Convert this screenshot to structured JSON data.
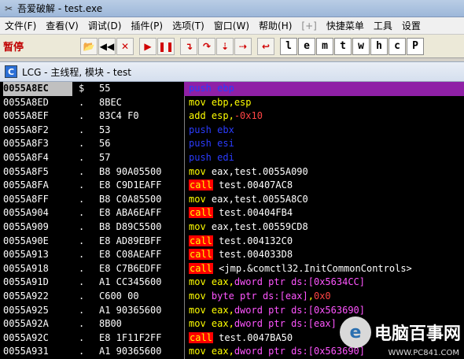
{
  "window": {
    "title": "吾爱破解 - test.exe"
  },
  "menu": [
    {
      "label": "文件(F)",
      "disabled": false
    },
    {
      "label": "查看(V)",
      "disabled": false
    },
    {
      "label": "调试(D)",
      "disabled": false
    },
    {
      "label": "插件(P)",
      "disabled": false
    },
    {
      "label": "选项(T)",
      "disabled": false
    },
    {
      "label": "窗口(W)",
      "disabled": false
    },
    {
      "label": "帮助(H)",
      "disabled": false
    },
    {
      "label": "[+]",
      "disabled": true
    },
    {
      "label": "快捷菜单",
      "disabled": false
    },
    {
      "label": "工具",
      "disabled": false
    },
    {
      "label": "设置",
      "disabled": false
    }
  ],
  "toolbar": {
    "status": "暂停",
    "buttons": [
      {
        "name": "open-icon",
        "glyph": "📂"
      },
      {
        "name": "rewind-icon",
        "glyph": "◀◀"
      },
      {
        "name": "close-process-icon",
        "glyph": "✕"
      },
      {
        "name": "run-icon",
        "glyph": "▶"
      },
      {
        "name": "pause-icon",
        "glyph": "❚❚"
      },
      {
        "name": "step-into-icon",
        "glyph": "↴"
      },
      {
        "name": "step-over-icon",
        "glyph": "↷"
      },
      {
        "name": "trace-into-icon",
        "glyph": "⇣"
      },
      {
        "name": "trace-over-icon",
        "glyph": "⇢"
      },
      {
        "name": "execute-till-return-icon",
        "glyph": "↩"
      }
    ],
    "letters": [
      "l",
      "e",
      "m",
      "t",
      "w",
      "h",
      "c",
      "P"
    ]
  },
  "child_window": {
    "title": "LCG - 主线程, 模块 - test"
  },
  "disasm_rows": [
    {
      "addr": "0055A8EC",
      "mark": "$",
      "hex": "55",
      "mnem": "push",
      "ops": [
        {
          "t": "ebp",
          "c": "mn-push"
        }
      ]
    },
    {
      "addr": "0055A8ED",
      "mark": ".",
      "hex": "8BEC",
      "mnem": "mov",
      "ops": [
        {
          "t": "ebp,esp",
          "c": "op-yel"
        }
      ]
    },
    {
      "addr": "0055A8EF",
      "mark": ".",
      "hex": "83C4 F0",
      "mnem": "add",
      "ops": [
        {
          "t": "esp,",
          "c": "op-yel"
        },
        {
          "t": "-0x10",
          "c": "op-red"
        }
      ]
    },
    {
      "addr": "0055A8F2",
      "mark": ".",
      "hex": "53",
      "mnem": "push",
      "ops": [
        {
          "t": "ebx",
          "c": "mn-push"
        }
      ]
    },
    {
      "addr": "0055A8F3",
      "mark": ".",
      "hex": "56",
      "mnem": "push",
      "ops": [
        {
          "t": "esi",
          "c": "mn-push"
        }
      ]
    },
    {
      "addr": "0055A8F4",
      "mark": ".",
      "hex": "57",
      "mnem": "push",
      "ops": [
        {
          "t": "edi",
          "c": "mn-push"
        }
      ]
    },
    {
      "addr": "0055A8F5",
      "mark": ".",
      "hex": "B8 90A05500",
      "mnem": "mov",
      "ops": [
        {
          "t": "eax,test.0055A090",
          "c": "op-white"
        }
      ]
    },
    {
      "addr": "0055A8FA",
      "mark": ".",
      "hex": "E8 C9D1EAFF",
      "mnem": "call",
      "ops": [
        {
          "t": "test.00407AC8",
          "c": "op-white"
        }
      ]
    },
    {
      "addr": "0055A8FF",
      "mark": ".",
      "hex": "B8 C0A85500",
      "mnem": "mov",
      "ops": [
        {
          "t": "eax,test.0055A8C0",
          "c": "op-white"
        }
      ]
    },
    {
      "addr": "0055A904",
      "mark": ".",
      "hex": "E8 ABA6EAFF",
      "mnem": "call",
      "ops": [
        {
          "t": "test.00404FB4",
          "c": "op-white"
        }
      ]
    },
    {
      "addr": "0055A909",
      "mark": ".",
      "hex": "B8 D89C5500",
      "mnem": "mov",
      "ops": [
        {
          "t": "eax,test.00559CD8",
          "c": "op-white"
        }
      ]
    },
    {
      "addr": "0055A90E",
      "mark": ".",
      "hex": "E8 AD89EBFF",
      "mnem": "call",
      "ops": [
        {
          "t": "test.004132C0",
          "c": "op-white"
        }
      ]
    },
    {
      "addr": "0055A913",
      "mark": ".",
      "hex": "E8 C08AEAFF",
      "mnem": "call",
      "ops": [
        {
          "t": "test.004033D8",
          "c": "op-white"
        }
      ]
    },
    {
      "addr": "0055A918",
      "mark": ".",
      "hex": "E8 C7B6EDFF",
      "mnem": "call",
      "ops": [
        {
          "t": "<jmp.&comctl32.InitCommonControls>",
          "c": "op-white"
        }
      ]
    },
    {
      "addr": "0055A91D",
      "mark": ".",
      "hex": "A1 CC345600",
      "mnem": "mov",
      "ops": [
        {
          "t": "eax,",
          "c": "op-yel"
        },
        {
          "t": "dword ptr ds:[0x5634CC]",
          "c": "op-mag"
        }
      ]
    },
    {
      "addr": "0055A922",
      "mark": ".",
      "hex": "C600 00",
      "mnem": "mov",
      "ops": [
        {
          "t": "byte ptr ds:[eax]",
          "c": "op-mag"
        },
        {
          "t": ",",
          "c": "op-yel"
        },
        {
          "t": "0x0",
          "c": "op-red"
        }
      ]
    },
    {
      "addr": "0055A925",
      "mark": ".",
      "hex": "A1 90365600",
      "mnem": "mov",
      "ops": [
        {
          "t": "eax,",
          "c": "op-yel"
        },
        {
          "t": "dword ptr ds:[0x563690]",
          "c": "op-mag"
        }
      ]
    },
    {
      "addr": "0055A92A",
      "mark": ".",
      "hex": "8B00",
      "mnem": "mov",
      "ops": [
        {
          "t": "eax,",
          "c": "op-yel"
        },
        {
          "t": "dword ptr ds:[eax]",
          "c": "op-mag"
        }
      ]
    },
    {
      "addr": "0055A92C",
      "mark": ".",
      "hex": "E8 1F11F2FF",
      "mnem": "call",
      "ops": [
        {
          "t": "test.0047BA50",
          "c": "op-white"
        }
      ]
    },
    {
      "addr": "0055A931",
      "mark": ".",
      "hex": "A1 90365600",
      "mnem": "mov",
      "ops": [
        {
          "t": "eax,",
          "c": "op-yel"
        },
        {
          "t": "dword ptr ds:[0x563690]",
          "c": "op-mag"
        }
      ]
    }
  ],
  "watermark": {
    "logo": "e",
    "text": "电脑百事网",
    "url": "WWW.PC841.COM"
  }
}
